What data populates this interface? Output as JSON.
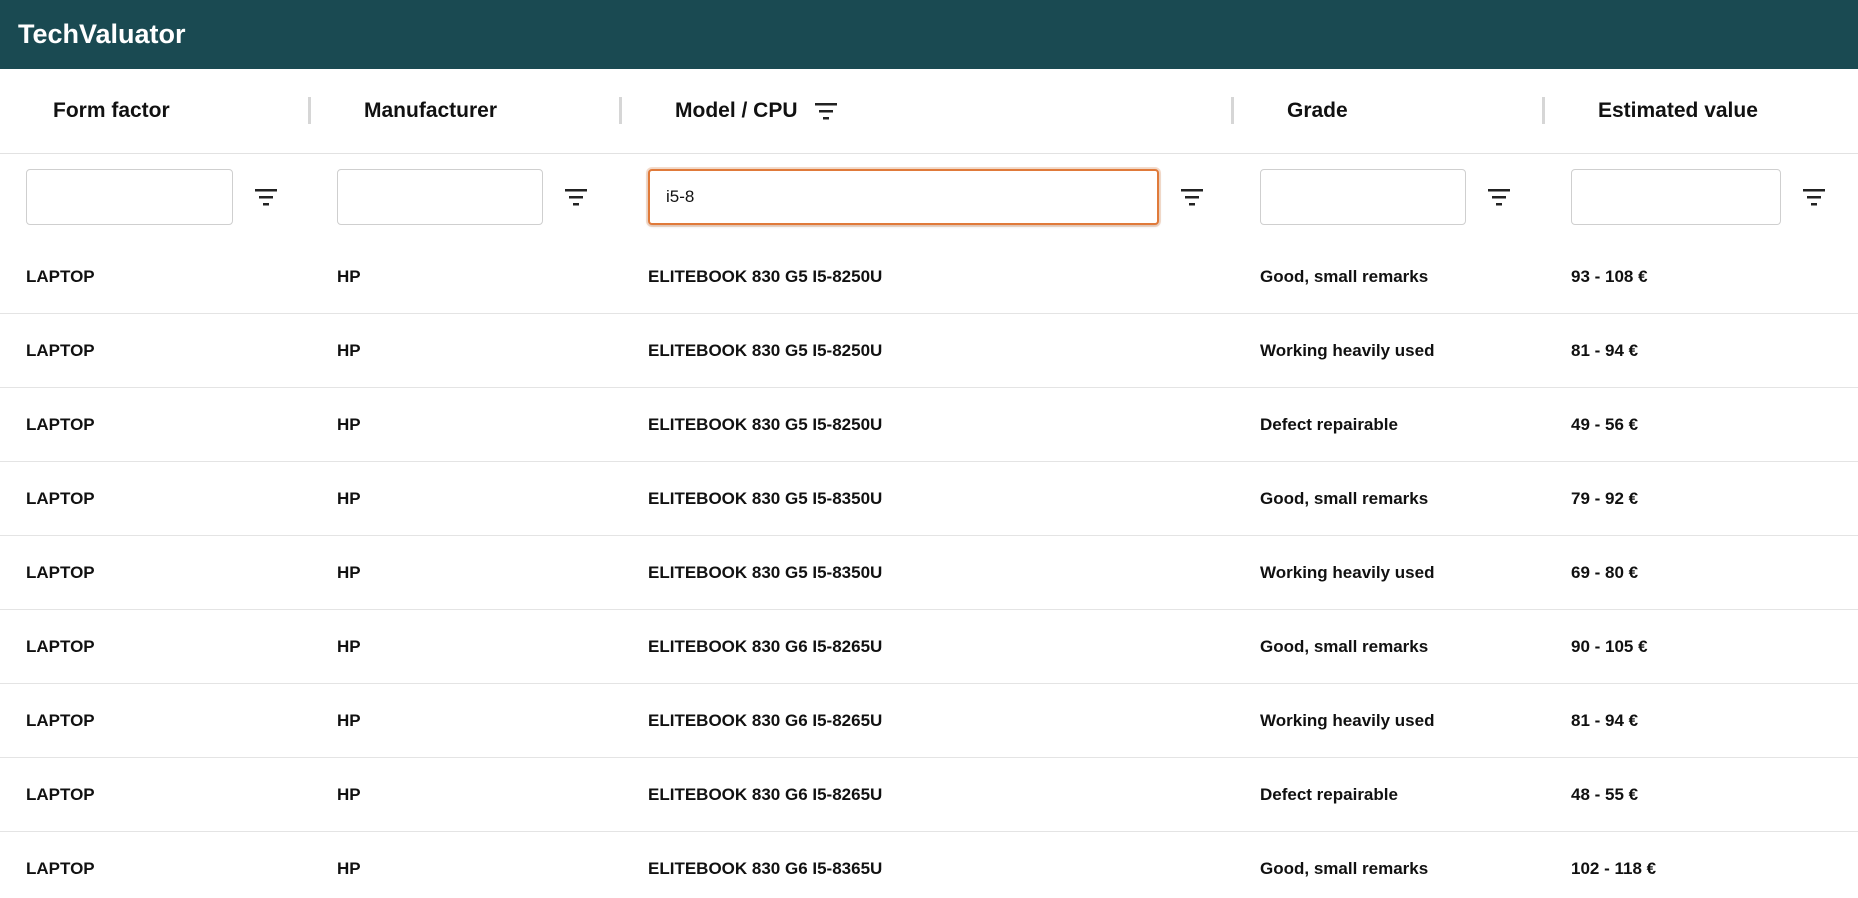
{
  "app": {
    "title": "TechValuator"
  },
  "columns": [
    {
      "label": "Form factor",
      "filter_value": ""
    },
    {
      "label": "Manufacturer",
      "filter_value": ""
    },
    {
      "label": "Model / CPU",
      "filter_value": "i5-8",
      "sorted_filter_active": true
    },
    {
      "label": "Grade",
      "filter_value": ""
    },
    {
      "label": "Estimated value",
      "filter_value": ""
    }
  ],
  "icons": {
    "filter": "filter-lines-icon"
  },
  "colors": {
    "header_bg": "#1a4a52",
    "active_input_border": "#e07a3a"
  },
  "rows": [
    {
      "form_factor": "LAPTOP",
      "manufacturer": "HP",
      "model": "ELITEBOOK 830 G5 I5-8250U",
      "grade": "Good, small remarks",
      "value": "93 - 108 €"
    },
    {
      "form_factor": "LAPTOP",
      "manufacturer": "HP",
      "model": "ELITEBOOK 830 G5 I5-8250U",
      "grade": "Working heavily used",
      "value": "81 - 94 €"
    },
    {
      "form_factor": "LAPTOP",
      "manufacturer": "HP",
      "model": "ELITEBOOK 830 G5 I5-8250U",
      "grade": "Defect repairable",
      "value": "49 - 56 €"
    },
    {
      "form_factor": "LAPTOP",
      "manufacturer": "HP",
      "model": "ELITEBOOK 830 G5 I5-8350U",
      "grade": "Good, small remarks",
      "value": "79 - 92 €"
    },
    {
      "form_factor": "LAPTOP",
      "manufacturer": "HP",
      "model": "ELITEBOOK 830 G5 I5-8350U",
      "grade": "Working heavily used",
      "value": "69 - 80 €"
    },
    {
      "form_factor": "LAPTOP",
      "manufacturer": "HP",
      "model": "ELITEBOOK 830 G6 I5-8265U",
      "grade": "Good, small remarks",
      "value": "90 - 105 €"
    },
    {
      "form_factor": "LAPTOP",
      "manufacturer": "HP",
      "model": "ELITEBOOK 830 G6 I5-8265U",
      "grade": "Working heavily used",
      "value": "81 - 94 €"
    },
    {
      "form_factor": "LAPTOP",
      "manufacturer": "HP",
      "model": "ELITEBOOK 830 G6 I5-8265U",
      "grade": "Defect repairable",
      "value": "48 - 55 €"
    },
    {
      "form_factor": "LAPTOP",
      "manufacturer": "HP",
      "model": "ELITEBOOK 830 G6 I5-8365U",
      "grade": "Good, small remarks",
      "value": "102 - 118 €"
    }
  ]
}
